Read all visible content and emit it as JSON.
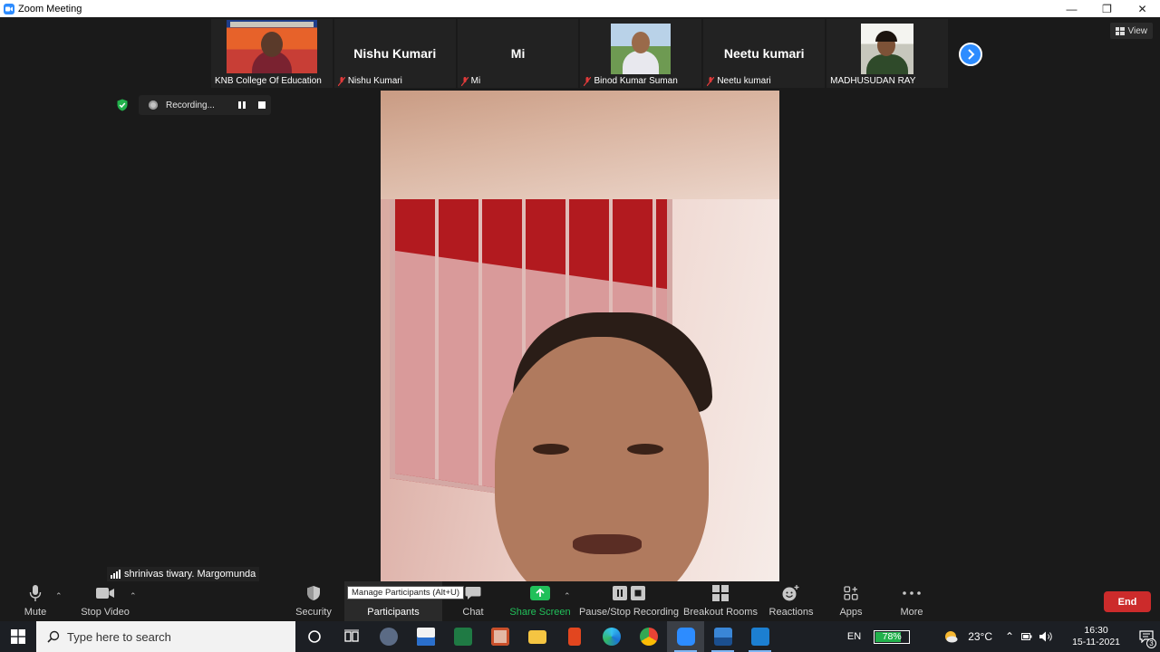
{
  "window": {
    "title": "Zoom Meeting",
    "minimize": "—",
    "maximize": "❐",
    "close": "✕"
  },
  "view_button": "View",
  "participants_strip": [
    {
      "label": "KNB College Of Education",
      "big_name": "",
      "muted": false,
      "has_video": true
    },
    {
      "label": "Nishu Kumari",
      "big_name": "Nishu Kumari",
      "muted": true,
      "has_video": false
    },
    {
      "label": "Mi",
      "big_name": "Mi",
      "muted": true,
      "has_video": false
    },
    {
      "label": "Binod Kumar Suman",
      "big_name": "",
      "muted": true,
      "has_video": true
    },
    {
      "label": "Neetu kumari",
      "big_name": "Neetu kumari",
      "muted": true,
      "has_video": false
    },
    {
      "label": "MADHUSUDAN RAY",
      "big_name": "",
      "muted": false,
      "has_video": true
    }
  ],
  "recording": {
    "status": "Recording..."
  },
  "active_speaker": {
    "name": "shrinivas tiwary. Margomunda"
  },
  "toolbar": {
    "mute": "Mute",
    "stop_video": "Stop Video",
    "security": "Security",
    "participants": "Participants",
    "participants_tooltip": "Manage Participants (Alt+U)",
    "chat": "Chat",
    "share_screen": "Share Screen",
    "pause_stop_recording": "Pause/Stop Recording",
    "breakout_rooms": "Breakout Rooms",
    "reactions": "Reactions",
    "apps": "Apps",
    "more": "More",
    "end": "End"
  },
  "taskbar": {
    "search_placeholder": "Type here to search",
    "language": "EN",
    "battery_percent": "78%",
    "battery_level": 0.78,
    "temperature": "23°C",
    "time": "16:30",
    "date": "15-11-2021",
    "notification_count": "3"
  },
  "colors": {
    "zoom_blue": "#2d8cff",
    "end_red": "#cc2b2b",
    "share_green": "#21c05a",
    "battery_green": "#22b14c"
  }
}
